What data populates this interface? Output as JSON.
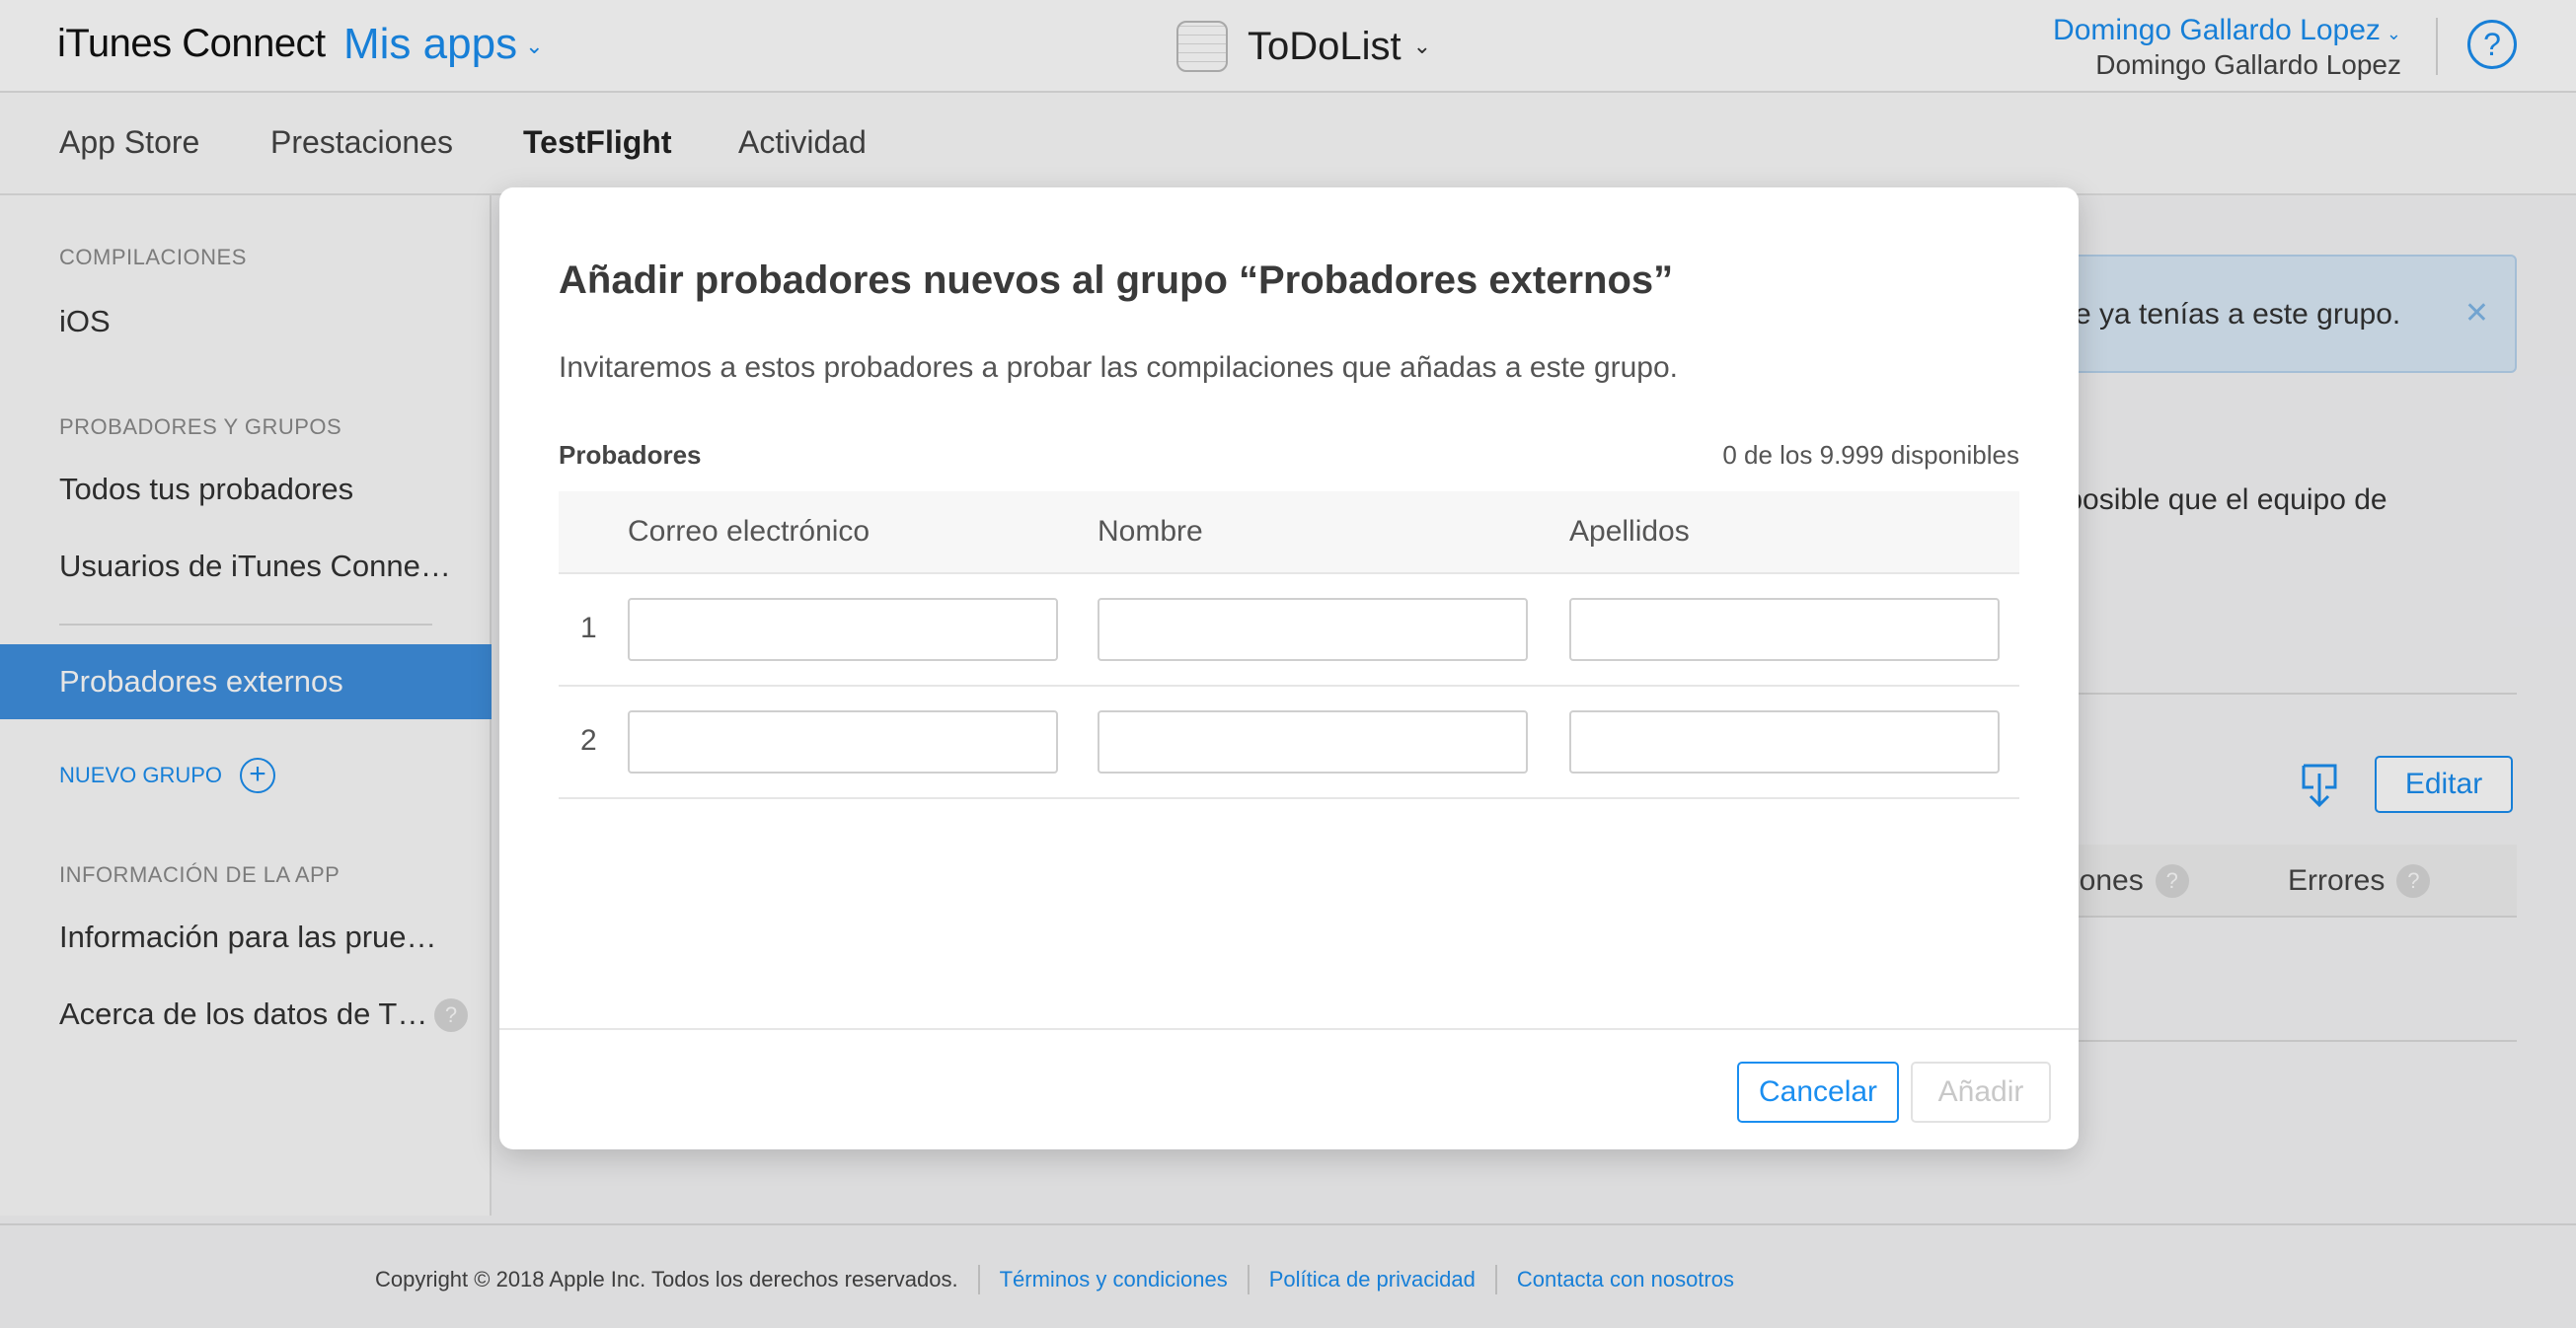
{
  "header": {
    "brand": "iTunes Connect",
    "my_apps": "Mis apps",
    "app_name": "ToDoList",
    "user_name": "Domingo Gallardo Lopez",
    "user_sub": "Domingo Gallardo Lopez",
    "help": "?"
  },
  "tabs": [
    {
      "label": "App Store"
    },
    {
      "label": "Prestaciones"
    },
    {
      "label": "TestFlight"
    },
    {
      "label": "Actividad"
    }
  ],
  "sidebar": {
    "builds_heading": "COMPILACIONES",
    "builds_ios": "iOS",
    "testers_heading": "PROBADORES Y GRUPOS",
    "all_testers": "Todos tus probadores",
    "itc_users": "Usuarios de iTunes Conne…",
    "external_testers": "Probadores externos",
    "new_group": "NUEVO GRUPO",
    "app_info_heading": "INFORMACIÓN DE LA APP",
    "test_info": "Información para las prue…",
    "about_data": "Acerca de los datos de T…"
  },
  "background": {
    "banner_text": "e ya tenías a este grupo.",
    "note_text": "s posible que el equipo de",
    "edit_label": "Editar",
    "col_sessions": "iones",
    "col_errors": "Errores"
  },
  "modal": {
    "title": "Añadir probadores nuevos al grupo “Probadores externos”",
    "description": "Invitaremos a estos probadores a probar las compilaciones que añadas a este grupo.",
    "testers_label": "Probadores",
    "available": "0 de los 9.999 disponibles",
    "columns": {
      "email": "Correo electrónico",
      "first_name": "Nombre",
      "last_name": "Apellidos"
    },
    "rows": [
      {
        "num": "1",
        "email": "",
        "first_name": "",
        "last_name": ""
      },
      {
        "num": "2",
        "email": "",
        "first_name": "",
        "last_name": ""
      }
    ],
    "cancel_label": "Cancelar",
    "add_label": "Añadir"
  },
  "footer": {
    "copyright": "Copyright © 2018 Apple Inc. Todos los derechos reservados.",
    "terms": "Términos y condiciones",
    "privacy": "Política de privacidad",
    "contact": "Contacta con nosotros"
  },
  "colors": {
    "accent": "#1a8ef0",
    "sidebar_selected": "#3f8fde",
    "banner_bg": "#dbeaf8"
  },
  "icons": [
    "chevron-down-icon",
    "app-icon",
    "help-icon",
    "plus-circle-icon",
    "help-badge-icon",
    "close-icon",
    "download-icon"
  ]
}
